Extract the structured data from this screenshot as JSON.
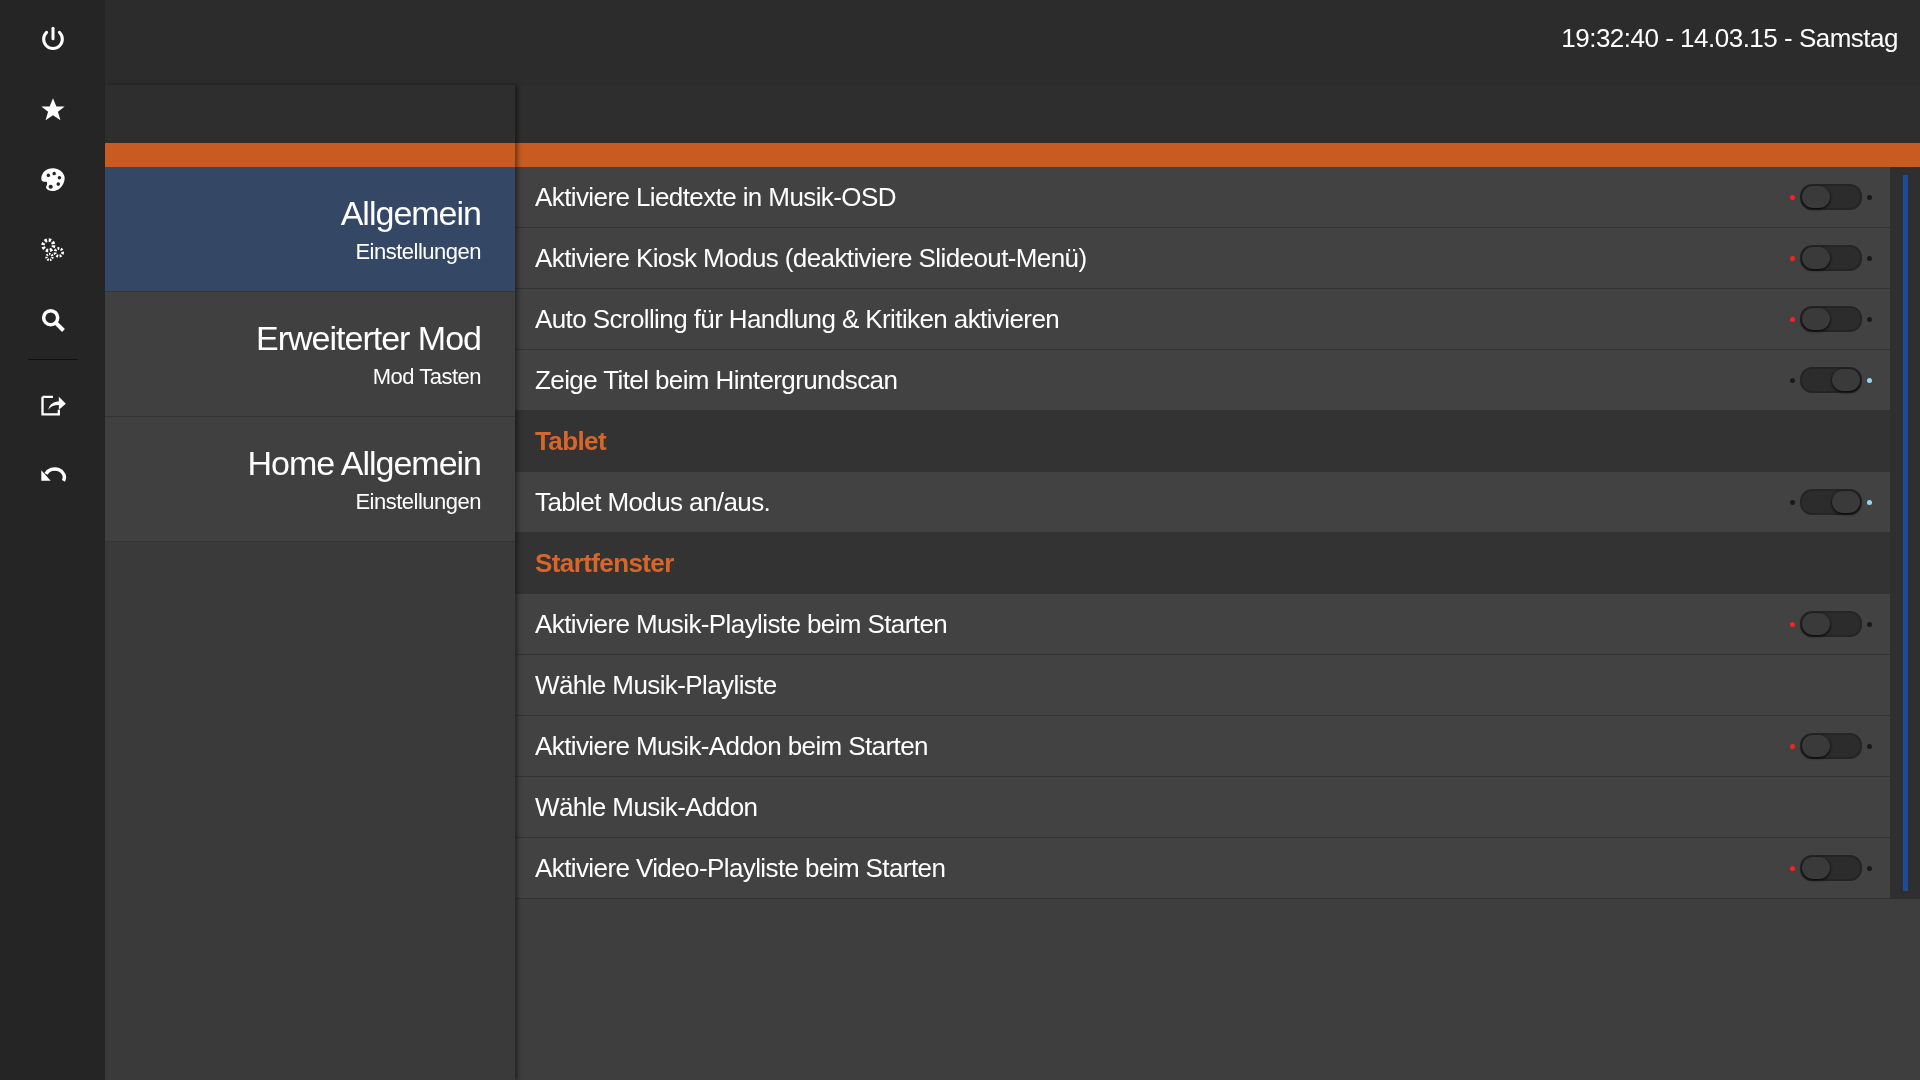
{
  "clock": "19:32:40 - 14.03.15 - Samstag",
  "categories": [
    {
      "title": "Allgemein",
      "subtitle": "Einstellungen",
      "selected": true
    },
    {
      "title": "Erweiterter Mod",
      "subtitle": "Mod Tasten",
      "selected": false
    },
    {
      "title": "Home Allgemein",
      "subtitle": "Einstellungen",
      "selected": false
    }
  ],
  "settings": [
    {
      "kind": "toggle",
      "label": "Aktiviere Liedtexte in Musik-OSD",
      "on": false
    },
    {
      "kind": "toggle",
      "label": "Aktiviere Kiosk Modus (deaktiviere Slideout-Menü)",
      "on": false
    },
    {
      "kind": "toggle",
      "label": "Auto Scrolling für Handlung & Kritiken aktivieren",
      "on": false
    },
    {
      "kind": "toggle",
      "label": "Zeige Titel beim Hintergrundscan",
      "on": true
    },
    {
      "kind": "header",
      "label": "Tablet"
    },
    {
      "kind": "toggle",
      "label": "Tablet Modus an/aus.",
      "on": true
    },
    {
      "kind": "header",
      "label": "Startfenster"
    },
    {
      "kind": "toggle",
      "label": "Aktiviere Musik-Playliste beim Starten",
      "on": false
    },
    {
      "kind": "action",
      "label": "Wähle Musik-Playliste"
    },
    {
      "kind": "toggle",
      "label": "Aktiviere Musik-Addon beim Starten",
      "on": false
    },
    {
      "kind": "action",
      "label": "Wähle Musik-Addon"
    },
    {
      "kind": "toggle",
      "label": "Aktiviere Video-Playliste beim Starten",
      "on": false
    }
  ]
}
